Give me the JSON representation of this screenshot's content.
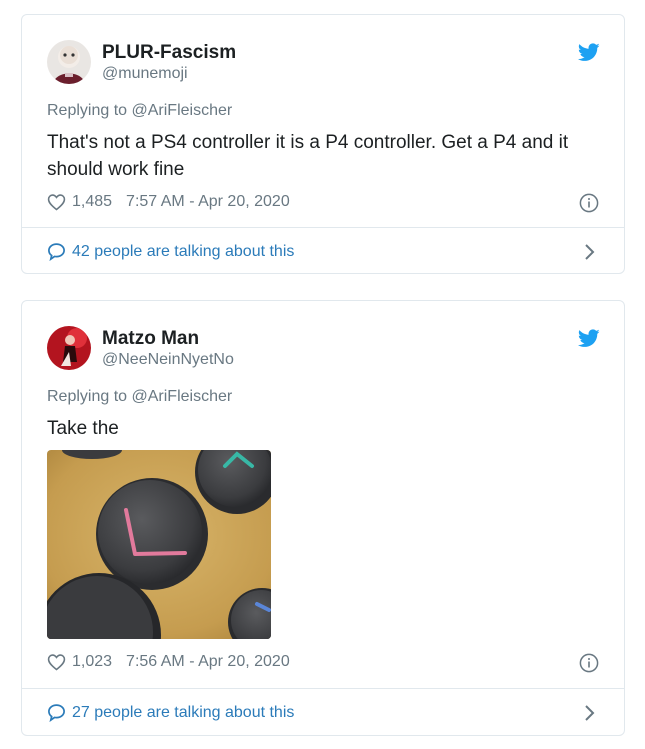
{
  "tweets": [
    {
      "name": "PLUR-Fascism",
      "handle": "@munemoji",
      "replying": "Replying to @AriFleischer",
      "text": "That's not a PS4 controller it is a P4 controller. Get a P4 and it should work fine",
      "likes": "1,485",
      "timestamp": "7:57 AM - Apr 20, 2020",
      "talking": "42 people are talking about this"
    },
    {
      "name": "Matzo Man",
      "handle": "@NeeNeinNyetNo",
      "replying": "Replying to @AriFleischer",
      "text": "Take the",
      "likes": "1,023",
      "timestamp": "7:56 AM - Apr 20, 2020",
      "talking": "27 people are talking about this"
    }
  ],
  "colors": {
    "twitter_blue": "#1da1f2",
    "link_blue": "#2b7bb9",
    "secondary_text": "#697882",
    "border": "#e1e8ed"
  },
  "icons": {
    "bird": "twitter-bird-icon",
    "like": "heart-icon",
    "info": "info-icon",
    "reply": "speech-bubble-icon",
    "more": "chevron-right-icon"
  }
}
